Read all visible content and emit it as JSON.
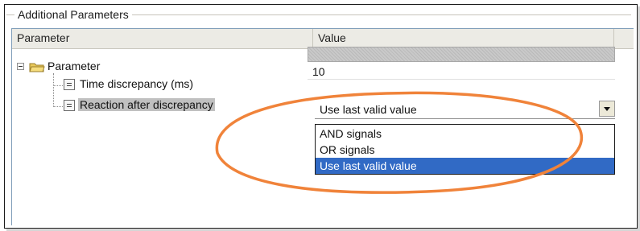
{
  "group": {
    "title": "Additional Parameters"
  },
  "table": {
    "columns": {
      "parameter": "Parameter",
      "value": "Value"
    },
    "tree": {
      "root": {
        "label": "Parameter",
        "expanded": true,
        "icon": "folder-icon"
      },
      "rows": [
        {
          "label": "Time discrepancy (ms)",
          "value": "10",
          "icon": "parameter-icon"
        },
        {
          "label": "Reaction after discrepancy",
          "value": "Use last valid value",
          "icon": "parameter-icon",
          "selected": true
        }
      ]
    }
  },
  "dropdown": {
    "selected": "Use last valid value",
    "options": [
      "AND signals",
      "OR signals",
      "Use last valid value"
    ],
    "highlighted_index": 2
  },
  "colors": {
    "highlight": "#316ac5",
    "annotation_ellipse": "#f0833a",
    "header_bg": "#ecebe5"
  }
}
